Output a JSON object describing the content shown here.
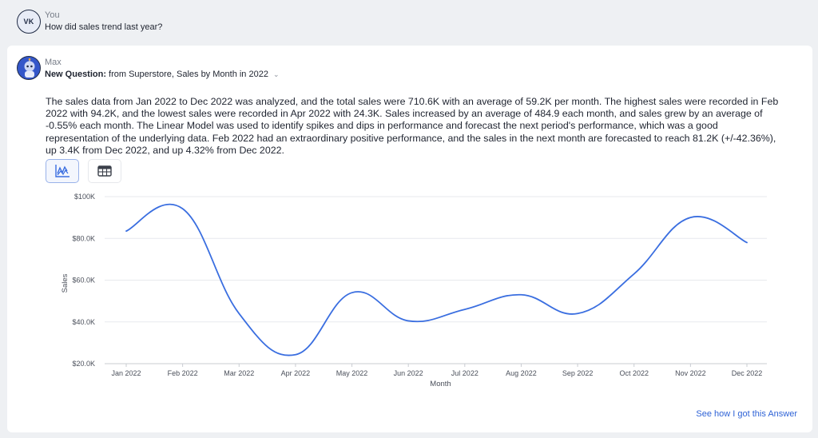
{
  "user": {
    "initials": "VK",
    "name": "You",
    "message": "How did sales trend last year?"
  },
  "assistant": {
    "name": "Max",
    "question_prefix": "New Question:",
    "question_text": "from Superstore, Sales by Month in 2022",
    "summary": "The sales data from Jan 2022 to Dec 2022 was analyzed, and the total sales were 710.6K with an average of 59.2K per month. The highest sales were recorded in Feb 2022 with 94.2K, and the lowest sales were recorded in Apr 2022 with 24.3K. Sales increased by an average of 484.9 each month, and sales grew by an average of -0.55% each month. The Linear Model was used to identify spikes and dips in performance and forecast the next period's performance, which was a good representation of the underlying data. Feb 2022 had an extraordinary positive performance, and the sales in the next month are forecasted to reach 81.2K (+/-42.36%), up 3.4K from Dec 2022, and up 4.32% from Dec 2022.",
    "footer_link": "See how I got this Answer"
  },
  "icons": {
    "chart_view": "line-chart-icon",
    "table_view": "table-icon"
  },
  "colors": {
    "line": "#3a6ee0",
    "link": "#2f63d6",
    "active_view_border": "#9ab3ea"
  },
  "chart_data": {
    "type": "line",
    "categories": [
      "Jan 2022",
      "Feb 2022",
      "Mar 2022",
      "Apr 2022",
      "May 2022",
      "Jun 2022",
      "Jul 2022",
      "Aug 2022",
      "Sep 2022",
      "Oct 2022",
      "Nov 2022",
      "Dec 2022"
    ],
    "series": [
      {
        "values": [
          83.5,
          94.2,
          44.0,
          24.3,
          54.0,
          40.5,
          46.0,
          53.0,
          44.0,
          63.0,
          90.0,
          78.0
        ]
      }
    ],
    "xlabel": "Month",
    "ylabel": "Sales",
    "ylim": [
      20,
      100
    ],
    "yticks": [
      20,
      40,
      60,
      80,
      100
    ],
    "ytick_labels": [
      "$20.0K",
      "$40.0K",
      "$60.0K",
      "$80.0K",
      "$100K"
    ],
    "grid": true
  }
}
